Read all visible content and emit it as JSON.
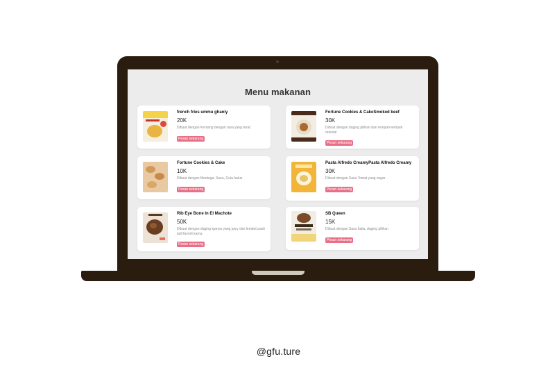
{
  "menu": {
    "title": "Menu makanan",
    "items": [
      {
        "name": "french fries ummu ghaniy",
        "price": "20K",
        "description": "Dibuat dengan Kentang dengan rasa yang lezat",
        "order_label": "Pesan sekarang",
        "thumbnail_icon": "french-fries-promo-image"
      },
      {
        "name": "Fortune Cookies & CakeSmoked beef",
        "price": "30K",
        "description": "Dibuat dengan daging pilihan dan rempah-rempah oriental",
        "order_label": "Pesan sekarang",
        "thumbnail_icon": "smoked-beef-image"
      },
      {
        "name": "Fortune Cookies & Cake",
        "price": "10K",
        "description": "Dibuat dengan Mentega, Susu, Gula halus.",
        "order_label": "Pesan sekarang",
        "thumbnail_icon": "fortune-cookies-image"
      },
      {
        "name": "Pasta Alfredo CreamyPasta Alfredo Creamy",
        "price": "30K",
        "description": "Dibuat dengan Saus Tomat yang segar",
        "order_label": "Pesan sekarang",
        "thumbnail_icon": "pasta-alfredo-image"
      },
      {
        "name": "Rib Eye Bone In El Machote",
        "price": "50K",
        "description": "Dibuat dengan daging iganya yang juicy dan lembut pasti jadi favorit kamu.",
        "order_label": "Pesan sekarang",
        "thumbnail_icon": "rib-eye-image"
      },
      {
        "name": "SB Queen",
        "price": "15K",
        "description": "Dibuat dengan Saus Italia, daging pilihan",
        "order_label": "Pesan sekarang",
        "thumbnail_icon": "sb-queen-image"
      }
    ]
  },
  "watermark": "@gfu.ture",
  "colors": {
    "laptop_body": "#2a1d10",
    "screen_bg": "#ececec",
    "order_button": "#e96f86"
  }
}
